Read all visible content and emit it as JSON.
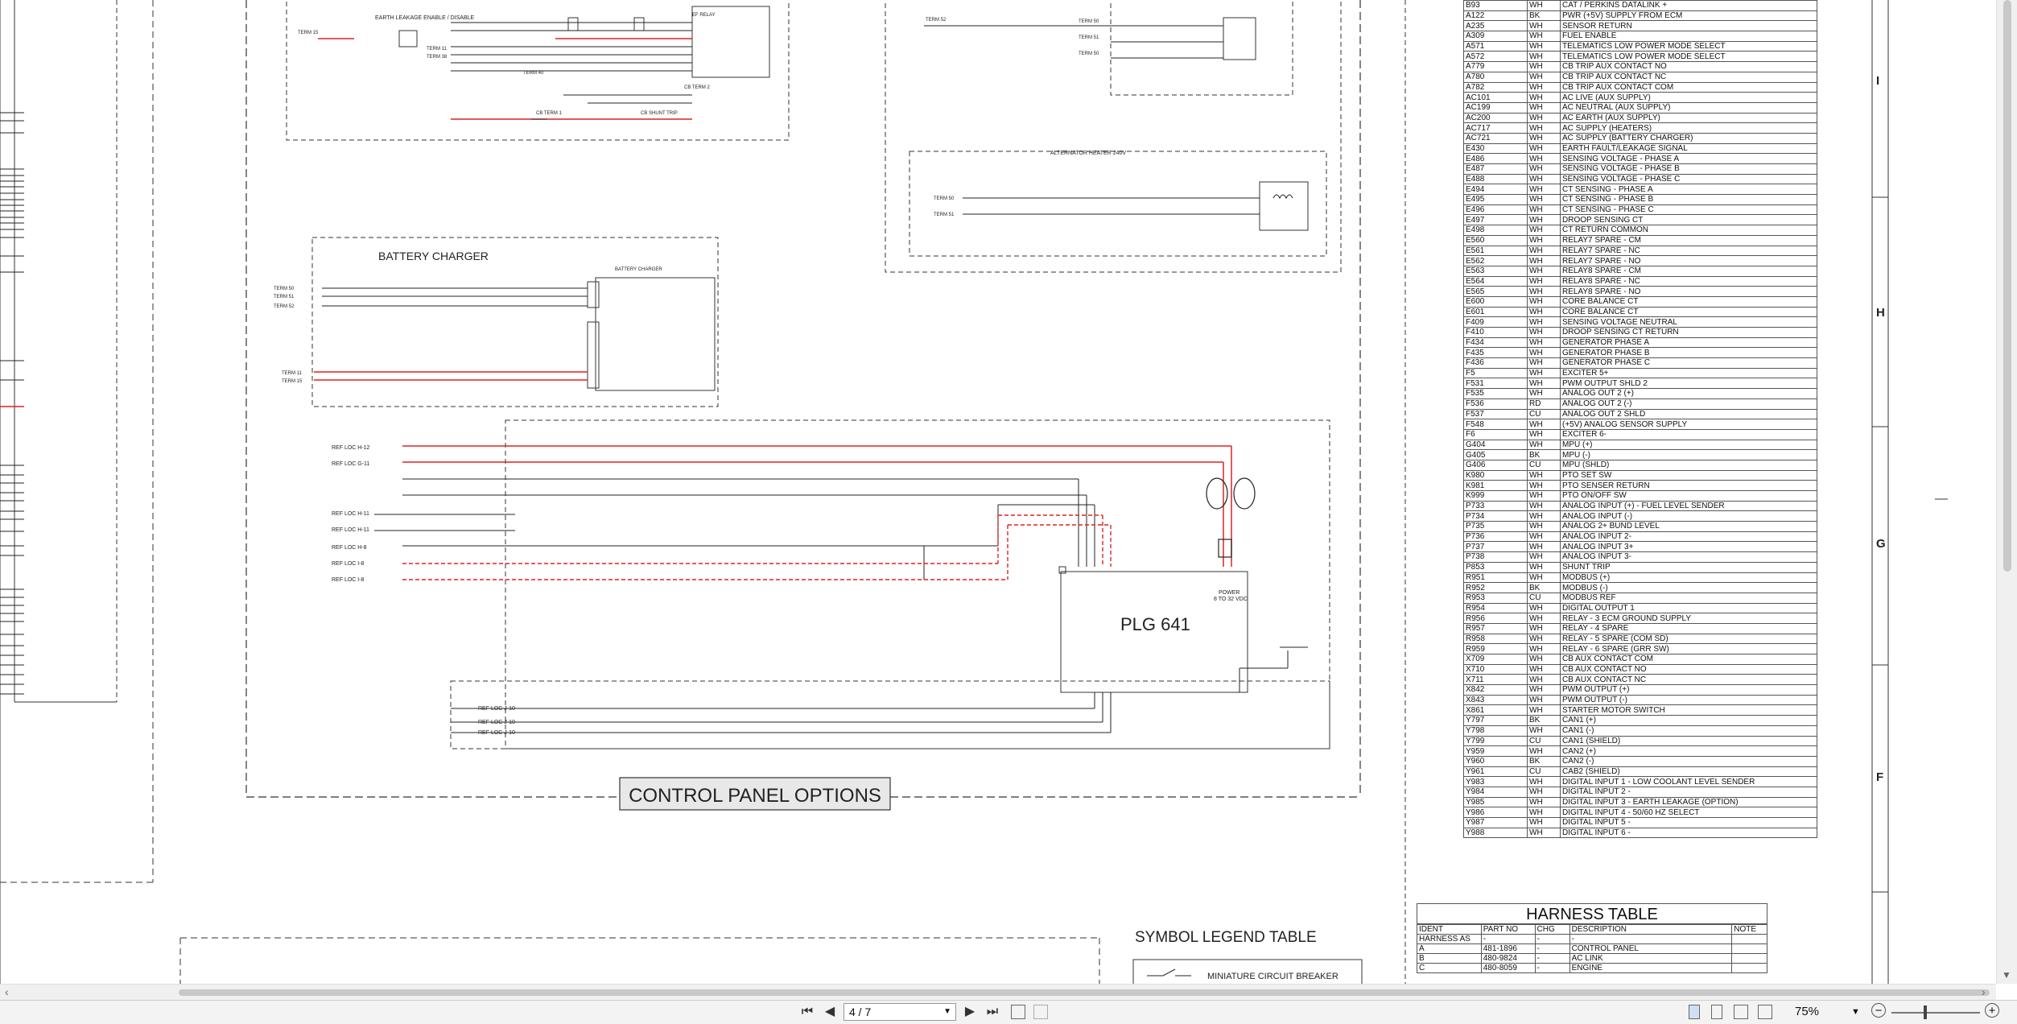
{
  "toolbar": {
    "page_value": "4 / 7",
    "zoom": "75%",
    "first_page": "⏮",
    "prev_page": "◀",
    "next_page": "▶",
    "last_page": "⏭"
  },
  "schematic": {
    "battery_charger_title": "BATTERY CHARGER",
    "battery_charger_label": "BATTERY CHARGER",
    "alt_heater_title": "ALTERNATOR HEATER 240V",
    "earth_leakage": "EARTH LEAKAGE ENABLE / DISABLE",
    "controller": "PLG 641",
    "control_panel_options": "CONTROL PANEL OPTIONS",
    "symbol_legend": "SYMBOL LEGEND TABLE",
    "mcb": "MINIATURE CIRCUIT BREAKER",
    "terms_left": [
      "TERM 15",
      "TERM 11",
      "TERM 38",
      "TERM 40",
      "TERM 50",
      "TERM 51",
      "TERM 52",
      "TERM 11",
      "TERM 15"
    ],
    "ref_locs": [
      "REF LOC H-12",
      "REF LOC G-11",
      "REF LOC H-11",
      "REF LOC H-11",
      "REF LOC H-8",
      "REF LOC I-8",
      "REF LOC I-8",
      "REF LOC J-10",
      "REF LOC J-10",
      "REF LOC J-10"
    ],
    "zone_letters": [
      "I",
      "H",
      "G",
      "F"
    ]
  },
  "wire_table": [
    [
      "B93",
      "WH",
      "CAT / PERKINS DATALINK +"
    ],
    [
      "A122",
      "BK",
      "PWR (+5V) SUPPLY FROM ECM"
    ],
    [
      "A235",
      "WH",
      "SENSOR RETURN"
    ],
    [
      "A309",
      "WH",
      "FUEL ENABLE"
    ],
    [
      "A571",
      "WH",
      "TELEMATICS LOW POWER MODE SELECT"
    ],
    [
      "A572",
      "WH",
      "TELEMATICS LOW POWER MODE SELECT"
    ],
    [
      "A779",
      "WH",
      "CB TRIP AUX CONTACT NO"
    ],
    [
      "A780",
      "WH",
      "CB TRIP AUX CONTACT NC"
    ],
    [
      "A782",
      "WH",
      "CB TRIP AUX CONTACT COM"
    ],
    [
      "AC101",
      "WH",
      "AC LIVE (AUX SUPPLY)"
    ],
    [
      "AC199",
      "WH",
      "AC NEUTRAL (AUX SUPPLY)"
    ],
    [
      "AC200",
      "WH",
      "AC EARTH (AUX SUPPLY)"
    ],
    [
      "AC717",
      "WH",
      "AC SUPPLY (HEATERS)"
    ],
    [
      "AC721",
      "WH",
      "AC SUPPLY (BATTERY CHARGER)"
    ],
    [
      "E430",
      "WH",
      "EARTH FAULT/LEAKAGE SIGNAL"
    ],
    [
      "E486",
      "WH",
      "SENSING VOLTAGE - PHASE A"
    ],
    [
      "E487",
      "WH",
      "SENSING VOLTAGE - PHASE B"
    ],
    [
      "E488",
      "WH",
      "SENSING VOLTAGE - PHASE C"
    ],
    [
      "E494",
      "WH",
      "CT SENSING - PHASE A"
    ],
    [
      "E495",
      "WH",
      "CT SENSING - PHASE B"
    ],
    [
      "E496",
      "WH",
      "CT SENSING - PHASE C"
    ],
    [
      "E497",
      "WH",
      "DROOP SENSING CT"
    ],
    [
      "E498",
      "WH",
      "CT RETURN COMMON"
    ],
    [
      "E560",
      "WH",
      "RELAY7 SPARE - CM"
    ],
    [
      "E561",
      "WH",
      "RELAY7 SPARE - NC"
    ],
    [
      "E562",
      "WH",
      "RELAY7 SPARE - NO"
    ],
    [
      "E563",
      "WH",
      "RELAY8 SPARE - CM"
    ],
    [
      "E564",
      "WH",
      "RELAY8 SPARE - NC"
    ],
    [
      "E565",
      "WH",
      "RELAY8 SPARE - NO"
    ],
    [
      "E600",
      "WH",
      "CORE BALANCE CT"
    ],
    [
      "E601",
      "WH",
      "CORE BALANCE CT"
    ],
    [
      "F409",
      "WH",
      "SENSING VOLTAGE NEUTRAL"
    ],
    [
      "F410",
      "WH",
      "DROOP SENSING CT RETURN"
    ],
    [
      "F434",
      "WH",
      "GENERATOR PHASE A"
    ],
    [
      "F435",
      "WH",
      "GENERATOR PHASE B"
    ],
    [
      "F436",
      "WH",
      "GENERATOR PHASE C"
    ],
    [
      "F5",
      "WH",
      "EXCITER 5+"
    ],
    [
      "F531",
      "WH",
      "PWM OUTPUT SHLD 2"
    ],
    [
      "F535",
      "WH",
      "ANALOG OUT 2 (+)"
    ],
    [
      "F536",
      "RD",
      "ANALOG OUT 2 (-)"
    ],
    [
      "F537",
      "CU",
      "ANALOG OUT 2 SHLD"
    ],
    [
      "F548",
      "WH",
      "(+5V) ANALOG SENSOR SUPPLY"
    ],
    [
      "F6",
      "WH",
      "EXCITER 6-"
    ],
    [
      "G404",
      "WH",
      "MPU (+)"
    ],
    [
      "G405",
      "BK",
      "MPU (-)"
    ],
    [
      "G406",
      "CU",
      "MPU (SHLD)"
    ],
    [
      "K980",
      "WH",
      "PTO SET SW"
    ],
    [
      "K981",
      "WH",
      "PTO SENSER RETURN"
    ],
    [
      "K999",
      "WH",
      "PTO ON/OFF SW"
    ],
    [
      "P733",
      "WH",
      "ANALOG INPUT (+) - FUEL LEVEL SENDER"
    ],
    [
      "P734",
      "WH",
      "ANALOG INPUT (-)"
    ],
    [
      "P735",
      "WH",
      "ANALOG 2+ BUND LEVEL"
    ],
    [
      "P736",
      "WH",
      "ANALOG INPUT 2-"
    ],
    [
      "P737",
      "WH",
      "ANALOG INPUT 3+"
    ],
    [
      "P738",
      "WH",
      "ANALOG INPUT 3-"
    ],
    [
      "P853",
      "WH",
      "SHUNT TRIP"
    ],
    [
      "R951",
      "WH",
      "MODBUS (+)"
    ],
    [
      "R952",
      "BK",
      "MODBUS (-)"
    ],
    [
      "R953",
      "CU",
      "MODBUS REF"
    ],
    [
      "R954",
      "WH",
      "DIGITAL OUTPUT 1"
    ],
    [
      "R956",
      "WH",
      "RELAY - 3 ECM GROUND SUPPLY"
    ],
    [
      "R957",
      "WH",
      "RELAY - 4 SPARE"
    ],
    [
      "R958",
      "WH",
      "RELAY - 5 SPARE (COM SD)"
    ],
    [
      "R959",
      "WH",
      "RELAY - 6 SPARE (GRR SW)"
    ],
    [
      "X709",
      "WH",
      "CB AUX CONTACT COM"
    ],
    [
      "X710",
      "WH",
      "CB AUX CONTACT NO"
    ],
    [
      "X711",
      "WH",
      "CB AUX CONTACT NC"
    ],
    [
      "X842",
      "WH",
      "PWM OUTPUT (+)"
    ],
    [
      "X843",
      "WH",
      "PWM OUTPUT (-)"
    ],
    [
      "X861",
      "WH",
      "STARTER MOTOR SWITCH"
    ],
    [
      "Y797",
      "BK",
      "CAN1 (+)"
    ],
    [
      "Y798",
      "WH",
      "CAN1 (-)"
    ],
    [
      "Y799",
      "CU",
      "CAN1 (SHIELD)"
    ],
    [
      "Y959",
      "WH",
      "CAN2 (+)"
    ],
    [
      "Y960",
      "BK",
      "CAN2 (-)"
    ],
    [
      "Y961",
      "CU",
      "CAB2 (SHIELD)"
    ],
    [
      "Y983",
      "WH",
      "DIGITAL INPUT 1 - LOW COOLANT LEVEL SENDER"
    ],
    [
      "Y984",
      "WH",
      "DIGITAL INPUT 2 -"
    ],
    [
      "Y985",
      "WH",
      "DIGITAL INPUT 3 - EARTH LEAKAGE (OPTION)"
    ],
    [
      "Y986",
      "WH",
      "DIGITAL INPUT 4 - 50/60 HZ SELECT"
    ],
    [
      "Y987",
      "WH",
      "DIGITAL INPUT 5 -"
    ],
    [
      "Y988",
      "WH",
      "DIGITAL INPUT 6 -"
    ]
  ],
  "harness_table": {
    "title": "HARNESS TABLE",
    "headers": [
      "IDENT",
      "PART NO",
      "CHG",
      "DESCRIPTION",
      "NOTE"
    ],
    "rows": [
      [
        "HARNESS AS",
        "-",
        "-",
        "-",
        ""
      ],
      [
        "A",
        "481-1896",
        "-",
        "CONTROL PANEL",
        ""
      ],
      [
        "B",
        "480-9824",
        "-",
        "AC LINK",
        ""
      ],
      [
        "C",
        "480-8059",
        "-",
        "ENGINE",
        ""
      ]
    ]
  }
}
